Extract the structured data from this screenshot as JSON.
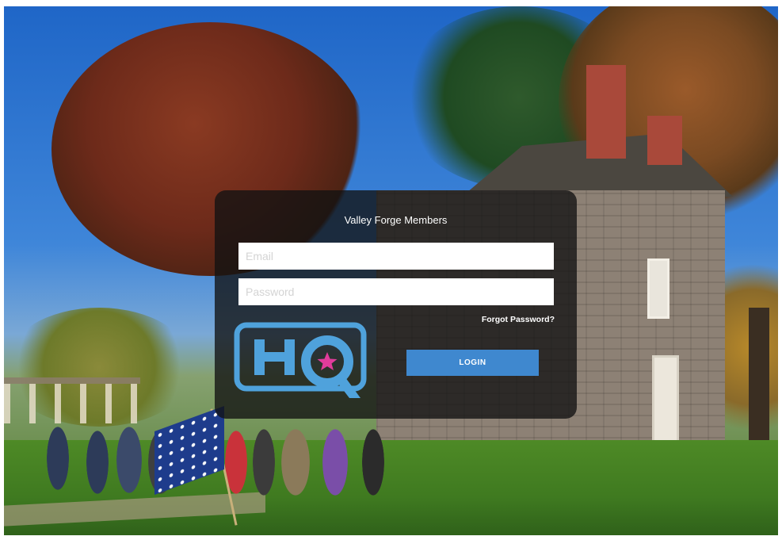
{
  "login": {
    "title": "Valley Forge Members",
    "email_placeholder": "Email",
    "password_placeholder": "Password",
    "forgot_password": "Forgot Password?",
    "login_button": "LOGIN"
  },
  "logo": {
    "text": "HQ",
    "icon": "star-icon"
  },
  "colors": {
    "accent": "#3f88cf",
    "logo_blue": "#4fa2dc",
    "star": "#e03c9b",
    "panel": "#121212"
  }
}
